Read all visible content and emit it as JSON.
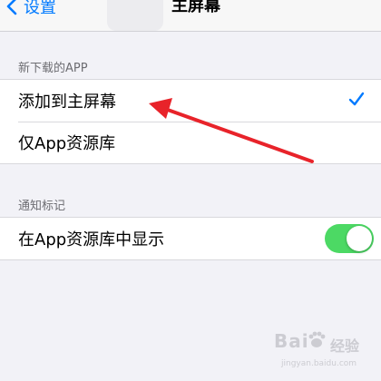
{
  "nav": {
    "back_label": "设置",
    "title": "主屏幕"
  },
  "sections": [
    {
      "header": "新下载的APP",
      "rows": [
        {
          "label": "添加到主屏幕",
          "selected": true
        },
        {
          "label": "仅App资源库",
          "selected": false
        }
      ]
    },
    {
      "header": "通知标记",
      "rows": [
        {
          "label": "在App资源库中显示",
          "toggle_on": true
        }
      ]
    }
  ],
  "colors": {
    "accent": "#007aff",
    "toggle_on": "#4cd964",
    "annotation_arrow": "#e8232a"
  },
  "watermark": {
    "brand": "Bai",
    "brand_suffix": "经验",
    "url": "jingyan.baidu.com"
  }
}
